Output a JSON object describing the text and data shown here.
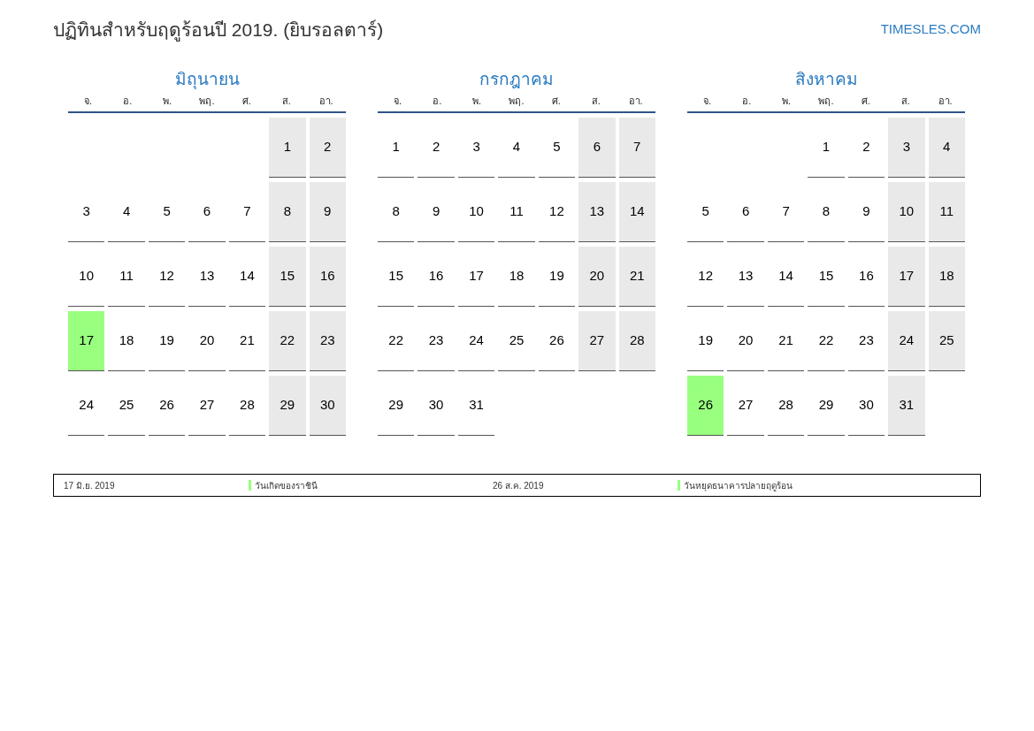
{
  "title": "ปฏิทินสำหรับฤดูร้อนปี 2019. (ยิบรอลตาร์)",
  "site_link": "TIMESLES.COM",
  "months": [
    {
      "name": "มิถุนายน",
      "weekdays": [
        "จ.",
        "อ.",
        "พ.",
        "พฤ.",
        "ศ.",
        "ส.",
        "อา."
      ],
      "weeks": [
        [
          {
            "kind": "blank"
          },
          {
            "kind": "blank"
          },
          {
            "kind": "blank"
          },
          {
            "kind": "blank"
          },
          {
            "kind": "blank"
          },
          {
            "day": "1",
            "weekend": true,
            "holiday": false
          },
          {
            "day": "2",
            "weekend": true,
            "holiday": false
          }
        ],
        [
          {
            "day": "3",
            "weekend": false,
            "holiday": false
          },
          {
            "day": "4",
            "weekend": false,
            "holiday": false
          },
          {
            "day": "5",
            "weekend": false,
            "holiday": false
          },
          {
            "day": "6",
            "weekend": false,
            "holiday": false
          },
          {
            "day": "7",
            "weekend": false,
            "holiday": false
          },
          {
            "day": "8",
            "weekend": true,
            "holiday": false
          },
          {
            "day": "9",
            "weekend": true,
            "holiday": false
          }
        ],
        [
          {
            "day": "10",
            "weekend": false,
            "holiday": false
          },
          {
            "day": "11",
            "weekend": false,
            "holiday": false
          },
          {
            "day": "12",
            "weekend": false,
            "holiday": false
          },
          {
            "day": "13",
            "weekend": false,
            "holiday": false
          },
          {
            "day": "14",
            "weekend": false,
            "holiday": false
          },
          {
            "day": "15",
            "weekend": true,
            "holiday": false
          },
          {
            "day": "16",
            "weekend": true,
            "holiday": false
          }
        ],
        [
          {
            "day": "17",
            "weekend": false,
            "holiday": true
          },
          {
            "day": "18",
            "weekend": false,
            "holiday": false
          },
          {
            "day": "19",
            "weekend": false,
            "holiday": false
          },
          {
            "day": "20",
            "weekend": false,
            "holiday": false
          },
          {
            "day": "21",
            "weekend": false,
            "holiday": false
          },
          {
            "day": "22",
            "weekend": true,
            "holiday": false
          },
          {
            "day": "23",
            "weekend": true,
            "holiday": false
          }
        ],
        [
          {
            "day": "24",
            "weekend": false,
            "holiday": false
          },
          {
            "day": "25",
            "weekend": false,
            "holiday": false
          },
          {
            "day": "26",
            "weekend": false,
            "holiday": false
          },
          {
            "day": "27",
            "weekend": false,
            "holiday": false
          },
          {
            "day": "28",
            "weekend": false,
            "holiday": false
          },
          {
            "day": "29",
            "weekend": true,
            "holiday": false
          },
          {
            "day": "30",
            "weekend": true,
            "holiday": false
          }
        ]
      ]
    },
    {
      "name": "กรกฎาคม",
      "weekdays": [
        "จ.",
        "อ.",
        "พ.",
        "พฤ.",
        "ศ.",
        "ส.",
        "อา."
      ],
      "weeks": [
        [
          {
            "day": "1",
            "weekend": false,
            "holiday": false
          },
          {
            "day": "2",
            "weekend": false,
            "holiday": false
          },
          {
            "day": "3",
            "weekend": false,
            "holiday": false
          },
          {
            "day": "4",
            "weekend": false,
            "holiday": false
          },
          {
            "day": "5",
            "weekend": false,
            "holiday": false
          },
          {
            "day": "6",
            "weekend": true,
            "holiday": false
          },
          {
            "day": "7",
            "weekend": true,
            "holiday": false
          }
        ],
        [
          {
            "day": "8",
            "weekend": false,
            "holiday": false
          },
          {
            "day": "9",
            "weekend": false,
            "holiday": false
          },
          {
            "day": "10",
            "weekend": false,
            "holiday": false
          },
          {
            "day": "11",
            "weekend": false,
            "holiday": false
          },
          {
            "day": "12",
            "weekend": false,
            "holiday": false
          },
          {
            "day": "13",
            "weekend": true,
            "holiday": false
          },
          {
            "day": "14",
            "weekend": true,
            "holiday": false
          }
        ],
        [
          {
            "day": "15",
            "weekend": false,
            "holiday": false
          },
          {
            "day": "16",
            "weekend": false,
            "holiday": false
          },
          {
            "day": "17",
            "weekend": false,
            "holiday": false
          },
          {
            "day": "18",
            "weekend": false,
            "holiday": false
          },
          {
            "day": "19",
            "weekend": false,
            "holiday": false
          },
          {
            "day": "20",
            "weekend": true,
            "holiday": false
          },
          {
            "day": "21",
            "weekend": true,
            "holiday": false
          }
        ],
        [
          {
            "day": "22",
            "weekend": false,
            "holiday": false
          },
          {
            "day": "23",
            "weekend": false,
            "holiday": false
          },
          {
            "day": "24",
            "weekend": false,
            "holiday": false
          },
          {
            "day": "25",
            "weekend": false,
            "holiday": false
          },
          {
            "day": "26",
            "weekend": false,
            "holiday": false
          },
          {
            "day": "27",
            "weekend": true,
            "holiday": false
          },
          {
            "day": "28",
            "weekend": true,
            "holiday": false
          }
        ],
        [
          {
            "day": "29",
            "weekend": false,
            "holiday": false
          },
          {
            "day": "30",
            "weekend": false,
            "holiday": false
          },
          {
            "day": "31",
            "weekend": false,
            "holiday": false
          },
          {
            "kind": "blank"
          },
          {
            "kind": "blank"
          },
          {
            "kind": "blank"
          },
          {
            "kind": "blank"
          }
        ]
      ]
    },
    {
      "name": "สิงหาคม",
      "weekdays": [
        "จ.",
        "อ.",
        "พ.",
        "พฤ.",
        "ศ.",
        "ส.",
        "อา."
      ],
      "weeks": [
        [
          {
            "kind": "blank"
          },
          {
            "kind": "blank"
          },
          {
            "kind": "blank"
          },
          {
            "day": "1",
            "weekend": false,
            "holiday": false
          },
          {
            "day": "2",
            "weekend": false,
            "holiday": false
          },
          {
            "day": "3",
            "weekend": true,
            "holiday": false
          },
          {
            "day": "4",
            "weekend": true,
            "holiday": false
          }
        ],
        [
          {
            "day": "5",
            "weekend": false,
            "holiday": false
          },
          {
            "day": "6",
            "weekend": false,
            "holiday": false
          },
          {
            "day": "7",
            "weekend": false,
            "holiday": false
          },
          {
            "day": "8",
            "weekend": false,
            "holiday": false
          },
          {
            "day": "9",
            "weekend": false,
            "holiday": false
          },
          {
            "day": "10",
            "weekend": true,
            "holiday": false
          },
          {
            "day": "11",
            "weekend": true,
            "holiday": false
          }
        ],
        [
          {
            "day": "12",
            "weekend": false,
            "holiday": false
          },
          {
            "day": "13",
            "weekend": false,
            "holiday": false
          },
          {
            "day": "14",
            "weekend": false,
            "holiday": false
          },
          {
            "day": "15",
            "weekend": false,
            "holiday": false
          },
          {
            "day": "16",
            "weekend": false,
            "holiday": false
          },
          {
            "day": "17",
            "weekend": true,
            "holiday": false
          },
          {
            "day": "18",
            "weekend": true,
            "holiday": false
          }
        ],
        [
          {
            "day": "19",
            "weekend": false,
            "holiday": false
          },
          {
            "day": "20",
            "weekend": false,
            "holiday": false
          },
          {
            "day": "21",
            "weekend": false,
            "holiday": false
          },
          {
            "day": "22",
            "weekend": false,
            "holiday": false
          },
          {
            "day": "23",
            "weekend": false,
            "holiday": false
          },
          {
            "day": "24",
            "weekend": true,
            "holiday": false
          },
          {
            "day": "25",
            "weekend": true,
            "holiday": false
          }
        ],
        [
          {
            "day": "26",
            "weekend": false,
            "holiday": true
          },
          {
            "day": "27",
            "weekend": false,
            "holiday": false
          },
          {
            "day": "28",
            "weekend": false,
            "holiday": false
          },
          {
            "day": "29",
            "weekend": false,
            "holiday": false
          },
          {
            "day": "30",
            "weekend": false,
            "holiday": false
          },
          {
            "day": "31",
            "weekend": true,
            "holiday": false
          },
          {
            "kind": "blank"
          }
        ]
      ]
    }
  ],
  "legend": [
    {
      "date": "17 มิ.ย. 2019",
      "name": "วันเกิดของราชินี",
      "color": "#99ff7f"
    },
    {
      "date": "26 ส.ค. 2019",
      "name": "วันหยุดธนาคารปลายฤดูร้อน",
      "color": "#99ff7f"
    }
  ]
}
